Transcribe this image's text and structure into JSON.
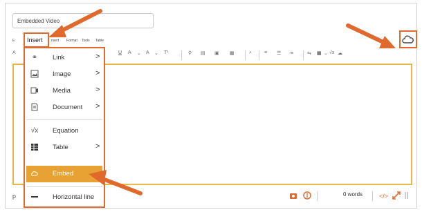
{
  "title_field": {
    "value": "Embedded Video"
  },
  "menubar": {
    "edit_label": "E",
    "view_label": "V",
    "insert_label": "Insert",
    "insert_ghost": "nsert",
    "format_label": "Format",
    "tools_label": "Tools",
    "table_label": "Table"
  },
  "toolbar": {
    "font_size_label": "A",
    "underline": "U",
    "text_color": "A",
    "highlight": "A",
    "superscript": "T¹"
  },
  "insert_menu": {
    "items": [
      {
        "icon": "link-icon",
        "label": "Link",
        "has_submenu": true
      },
      {
        "icon": "image-icon",
        "label": "Image",
        "has_submenu": true
      },
      {
        "icon": "media-icon",
        "label": "Media",
        "has_submenu": true
      },
      {
        "icon": "document-icon",
        "label": "Document",
        "has_submenu": true
      },
      {
        "icon": "equation-icon",
        "label": "Equation",
        "has_submenu": false
      },
      {
        "icon": "table-icon",
        "label": "Table",
        "has_submenu": true
      },
      {
        "icon": "embed-icon",
        "label": "Embed",
        "has_submenu": false,
        "highlighted": true
      },
      {
        "icon": "horizontal-line-icon",
        "label": "Horizontal line",
        "has_submenu": false
      }
    ],
    "submenu_arrow": ">"
  },
  "status_bar": {
    "paragraph_label": "p",
    "word_count": "0 words",
    "html_toggle": "</>"
  },
  "colors": {
    "highlight_orange": "#e8a233",
    "annotation_orange": "#e06a2e",
    "editor_border": "#e8b84a"
  }
}
